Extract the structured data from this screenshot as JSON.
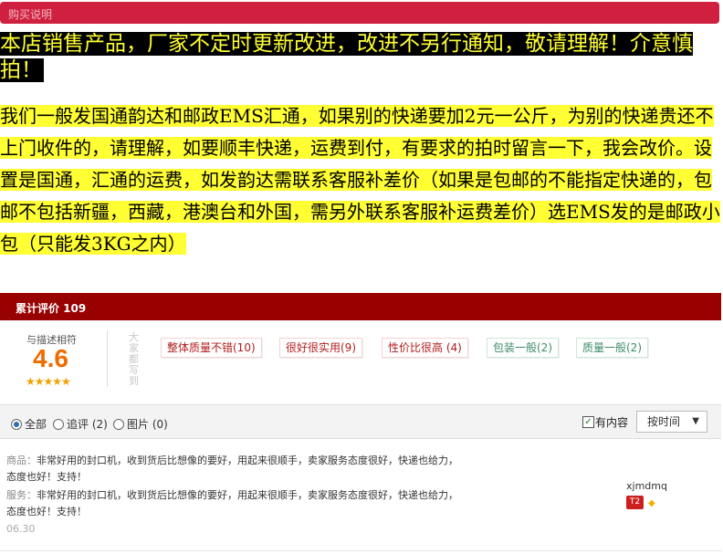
{
  "header": {
    "title": "购买说明"
  },
  "notice": {
    "text": "本店销售产品，厂家不定时更新改进，改进不另行通知，敬请理解！介意慎拍！"
  },
  "shipping": {
    "text": "我们一般发国通韵达和邮政EMS汇通，如果别的快递要加2元一公斤，为别的快递贵还不上门收件的，请理解，如要顺丰快递，运费到付，有要求的拍时留言一下，我会改价。设置是国通，汇通的运费，如发韵达需联系客服补差价（如果是包邮的不能指定快递的，包邮不包括新疆，西藏，港澳台和外国，需另外联系客服补运费差价）选EMS发的是邮政小包（只能发3KG之内）"
  },
  "reviews": {
    "title": "累计评价 109",
    "score_label": "与描述相符",
    "score": "4.6",
    "stars": "★★★★★",
    "vertical_text": "大家都写到",
    "tags": [
      {
        "label": "整体质量不错(10)",
        "tone": "red"
      },
      {
        "label": "很好很实用(9)",
        "tone": "red"
      },
      {
        "label": "性价比很高 (4)",
        "tone": "red"
      },
      {
        "label": "包装一般(2)",
        "tone": "green"
      },
      {
        "label": "质量一般(2)",
        "tone": "green"
      }
    ],
    "filters": {
      "all": "全部",
      "append": "追评 (2)",
      "image": "图片 (0)",
      "has_content": "有内容",
      "sort": "按时间"
    },
    "items": [
      {
        "product_label": "商品：",
        "product_text": "非常好用的封口机，收到货后比想像的要好，用起来很顺手，卖家服务态度很好，快递也给力，态度也好！支持！",
        "service_label": "服务：",
        "service_text": "非常好用的封口机，收到货后比想像的要好，用起来很顺手，卖家服务态度很好，快递也给力，态度也好！支持！",
        "date": "06.30",
        "user": "xjmdmq",
        "badge": "T2"
      }
    ]
  },
  "colors": {
    "header_red": "#d0203f",
    "review_bar": "#990000",
    "score": "#f06b00",
    "highlight": "#ffff33"
  }
}
